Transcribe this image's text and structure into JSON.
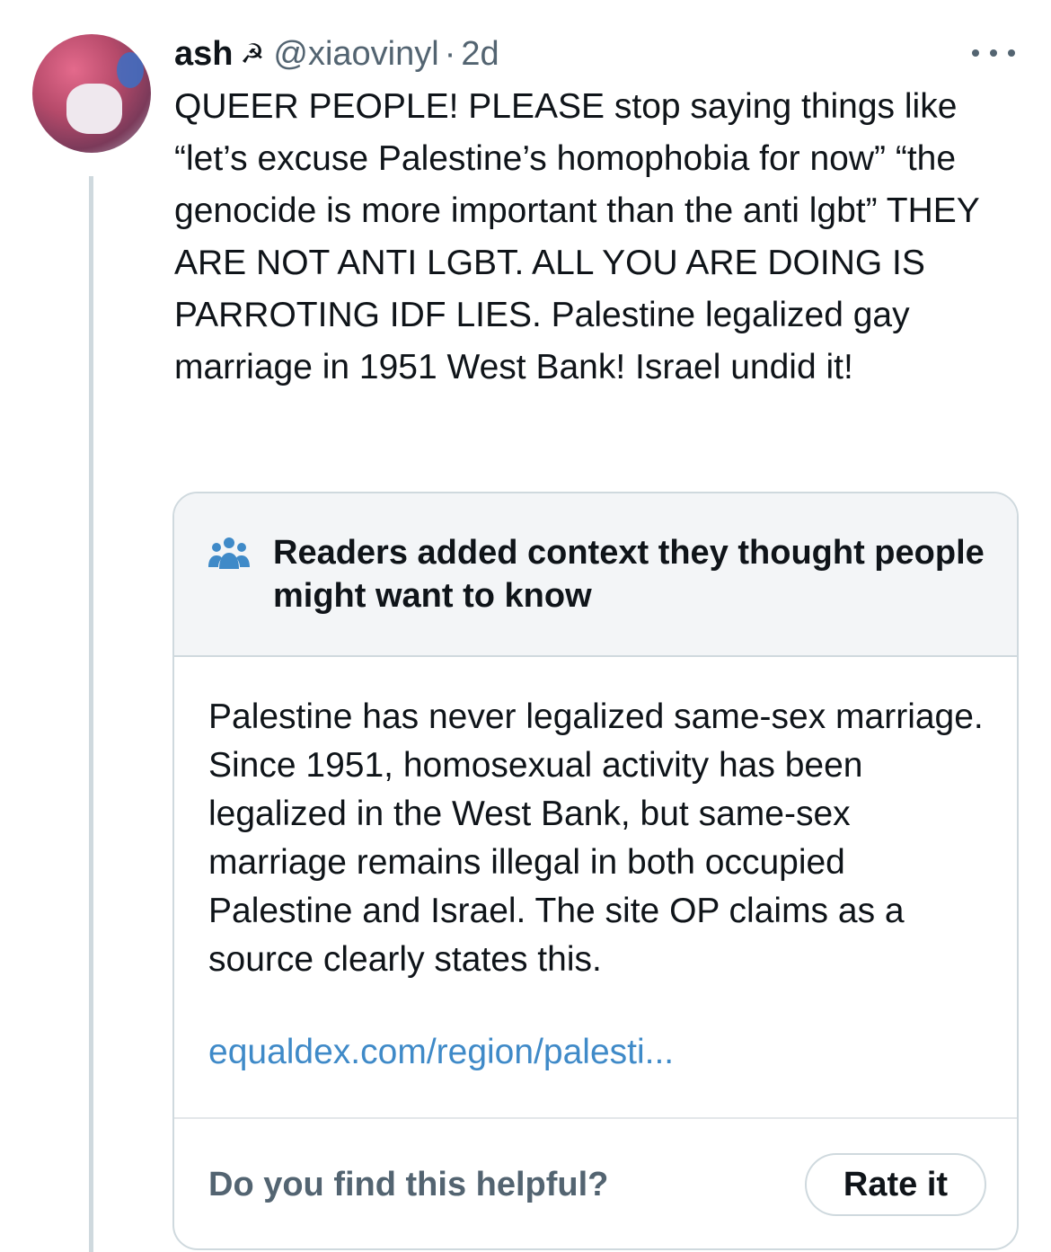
{
  "tweet": {
    "author_name": "ash",
    "author_emoji": "☭",
    "handle": "@xiaovinyl",
    "separator": "·",
    "time": "2d",
    "text": "QUEER PEOPLE! PLEASE stop saying things like “let’s excuse Palestine’s homophobia for now” “the genocide is more important than the anti lgbt” THEY ARE NOT ANTI LGBT. ALL YOU ARE DOING IS PARROTING IDF LIES. Palestine legalized gay marriage in 1951 West Bank! Israel undid it!"
  },
  "community_note": {
    "title": "Readers added context they thought people might want to know",
    "body": "Palestine has never legalized same-sex marriage. Since 1951, homosexual activity has been legalized in the West Bank, but same-sex marriage remains illegal in both occupied Palestine and Israel. The site OP claims as a source clearly states this.",
    "link_text": "equaldex.com/region/palesti...",
    "helpful_question": "Do you find this helpful?",
    "rate_label": "Rate it"
  },
  "colors": {
    "link": "#3f8ac8",
    "secondary_text": "#536471",
    "note_header_bg": "#f3f5f7",
    "border": "#cfd9de"
  },
  "icons": [
    "more-options-icon",
    "readers-group-icon"
  ]
}
